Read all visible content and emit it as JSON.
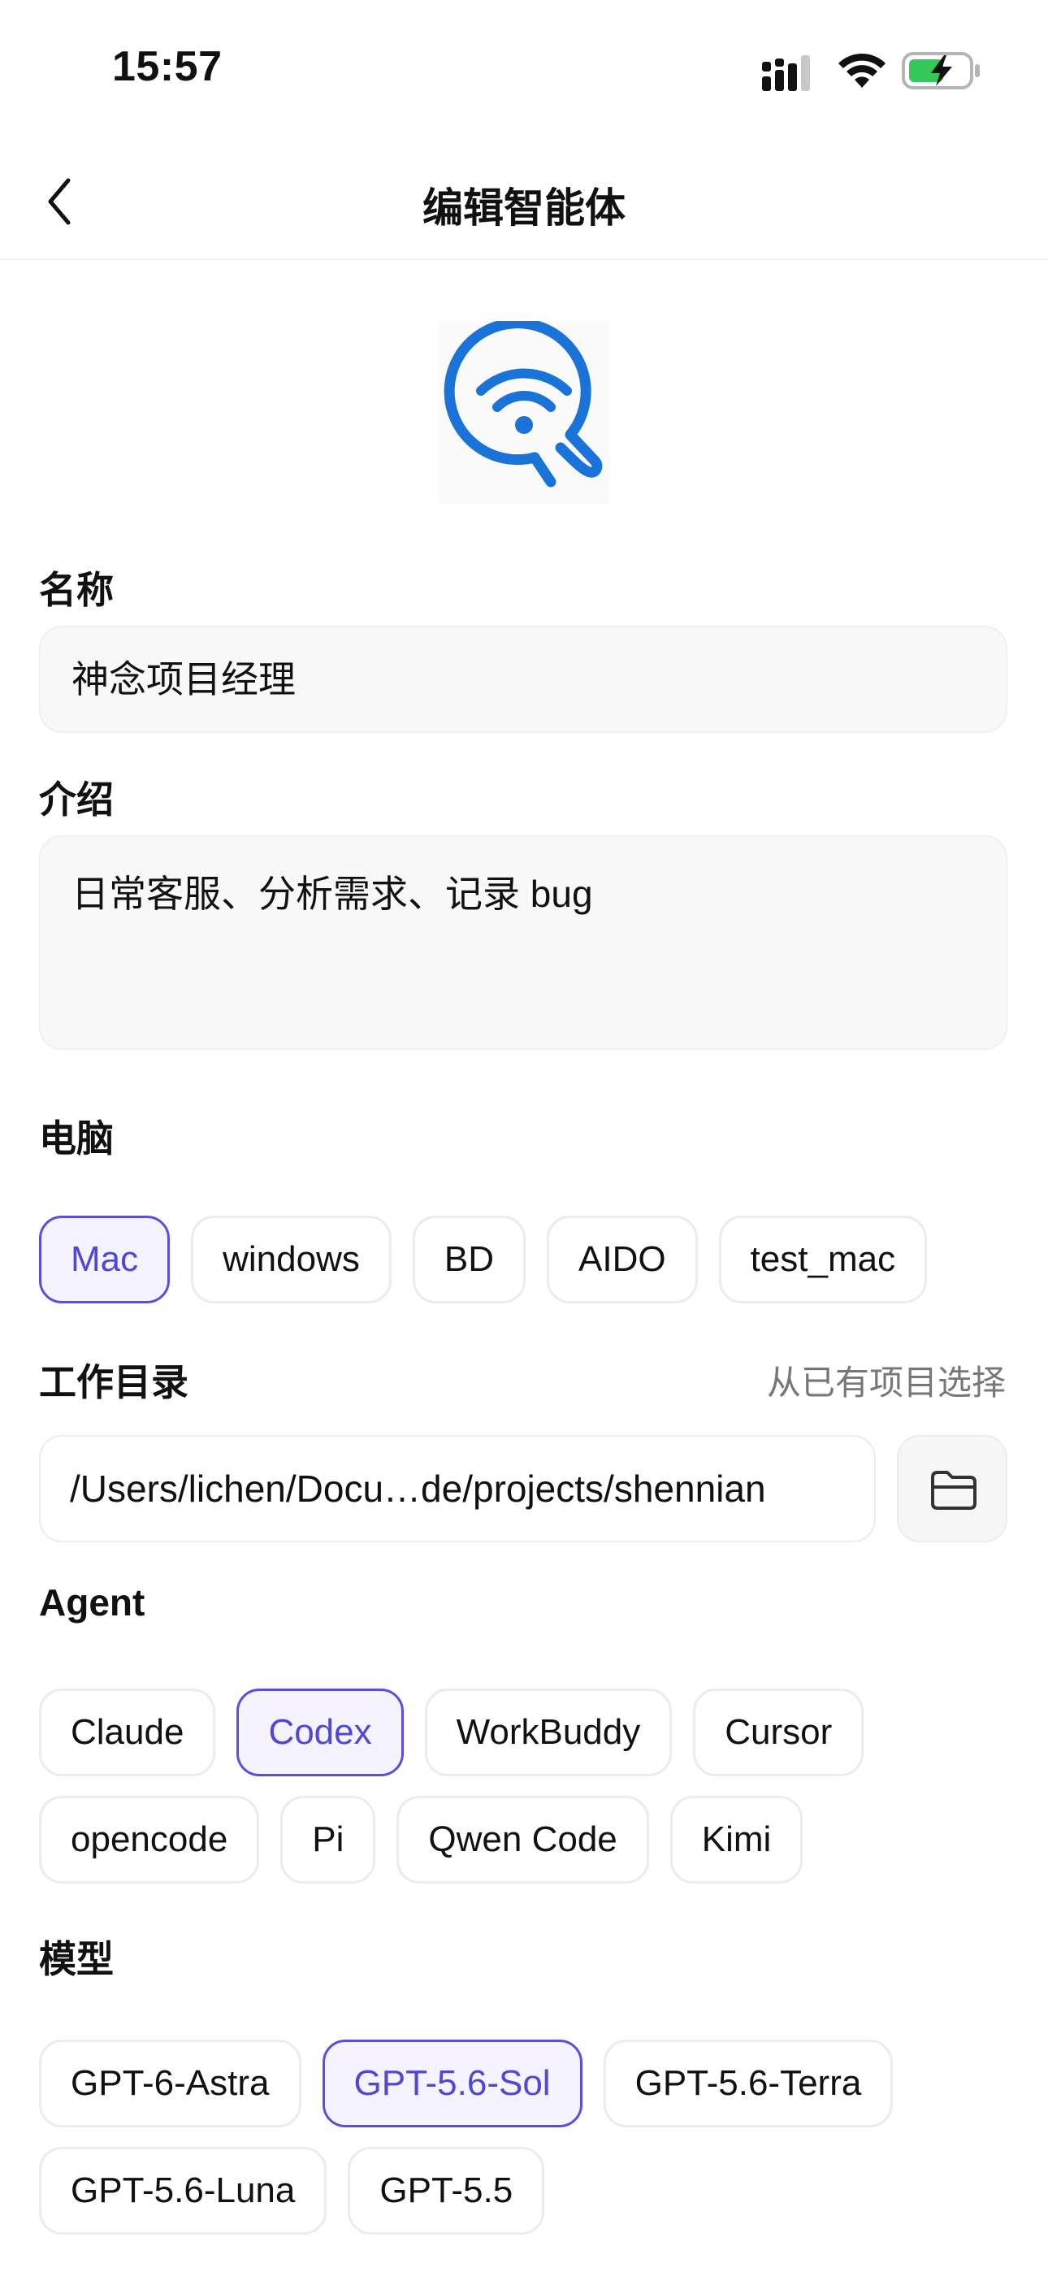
{
  "status_bar": {
    "time": "15:57"
  },
  "nav": {
    "title": "编辑智能体"
  },
  "form": {
    "name": {
      "label": "名称",
      "value": "神念项目经理"
    },
    "intro": {
      "label": "介绍",
      "value": "日常客服、分析需求、记录 bug"
    },
    "computer": {
      "label": "电脑",
      "options": [
        "Mac",
        "windows",
        "BD",
        "AIDO",
        "test_mac"
      ],
      "selected": "Mac"
    },
    "workdir": {
      "label": "工作目录",
      "link": "从已有项目选择",
      "value": "/Users/lichen/Docu…de/projects/shennian"
    },
    "agent": {
      "label": "Agent",
      "options": [
        "Claude",
        "Codex",
        "WorkBuddy",
        "Cursor",
        "opencode",
        "Pi",
        "Qwen Code",
        "Kimi"
      ],
      "selected": "Codex"
    },
    "model": {
      "label": "模型",
      "options": [
        "GPT-6-Astra",
        "GPT-5.6-Sol",
        "GPT-5.6-Terra",
        "GPT-5.6-Luna",
        "GPT-5.5"
      ],
      "selected": "GPT-5.6-Sol"
    }
  },
  "colors": {
    "accent": "#5a4ee0",
    "avatar_blue": "#1a73d9"
  },
  "icons": [
    "back-chevron-icon",
    "signal-icon",
    "wifi-icon",
    "battery-charging-icon",
    "agent-avatar-icon",
    "folder-icon"
  ]
}
